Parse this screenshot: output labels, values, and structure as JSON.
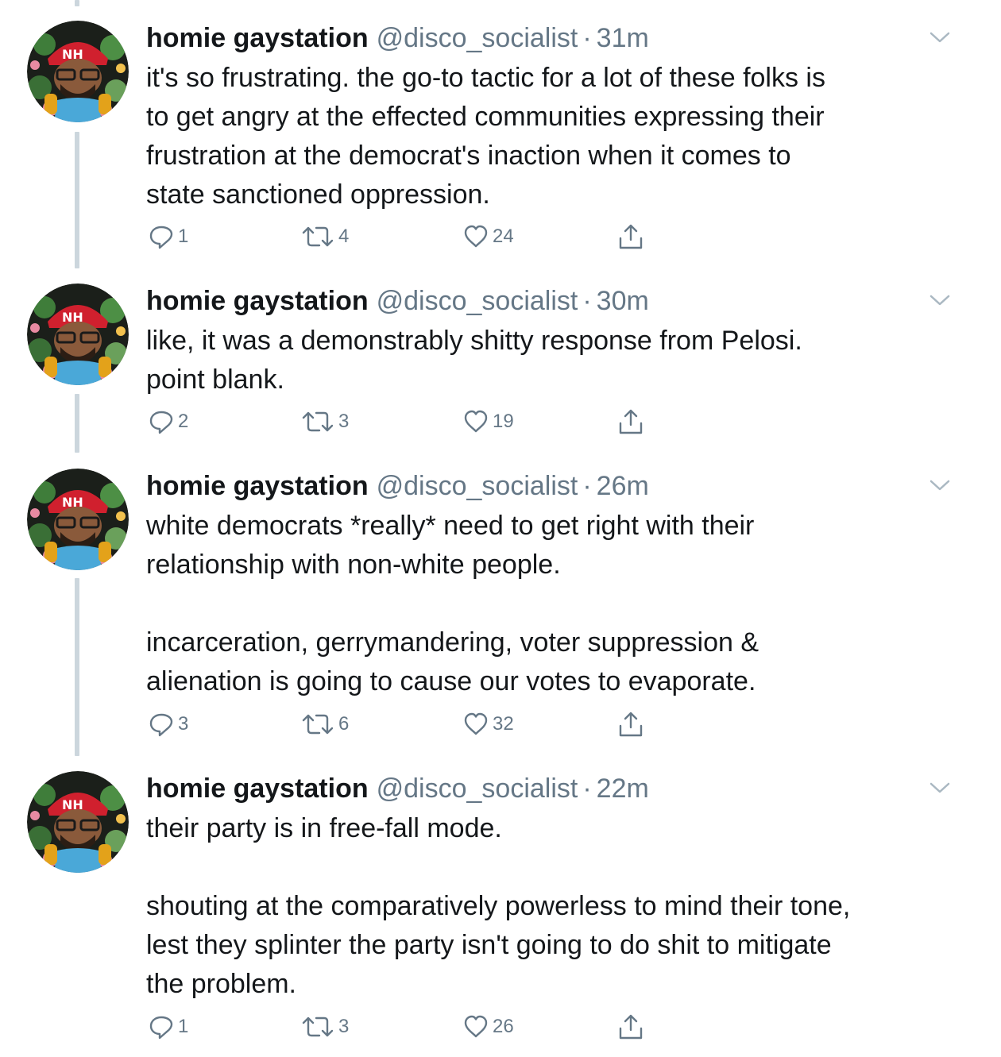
{
  "tweets": [
    {
      "name": "homie gaystation",
      "handle": "@disco_socialist",
      "separator": "·",
      "time": "31m",
      "text": "it's so frustrating. the go-to tactic for a lot of these folks is\nto get angry at the effected communities expressing their\nfrustration at the democrat's inaction when it comes to\nstate sanctioned oppression.",
      "replies": "1",
      "retweets": "4",
      "likes": "24"
    },
    {
      "name": "homie gaystation",
      "handle": "@disco_socialist",
      "separator": "·",
      "time": "30m",
      "text": "like, it was a demonstrably shitty response from Pelosi.\npoint blank.",
      "replies": "2",
      "retweets": "3",
      "likes": "19"
    },
    {
      "name": "homie gaystation",
      "handle": "@disco_socialist",
      "separator": "·",
      "time": "26m",
      "text": "white democrats *really* need to get right with their\nrelationship with non-white people.\n\nincarceration, gerrymandering, voter suppression &\nalienation is going to cause our votes to evaporate.",
      "replies": "3",
      "retweets": "6",
      "likes": "32"
    },
    {
      "name": "homie gaystation",
      "handle": "@disco_socialist",
      "separator": "·",
      "time": "22m",
      "text": "their party is in free-fall mode.\n\nshouting at the comparatively powerless to mind their tone,\nlest they splinter the party isn't going to do shit to mitigate\nthe problem.",
      "replies": "1",
      "retweets": "3",
      "likes": "26"
    }
  ],
  "colors": {
    "text": "#14171a",
    "secondary": "#657786",
    "thread_line": "#ccd6dd",
    "avatar_hat": "#d0202e"
  },
  "icons": {
    "reply": "reply-icon",
    "retweet": "retweet-icon",
    "like": "heart-icon",
    "share": "share-icon",
    "menu": "chevron-down-icon",
    "avatar": "avatar-cartoon"
  }
}
